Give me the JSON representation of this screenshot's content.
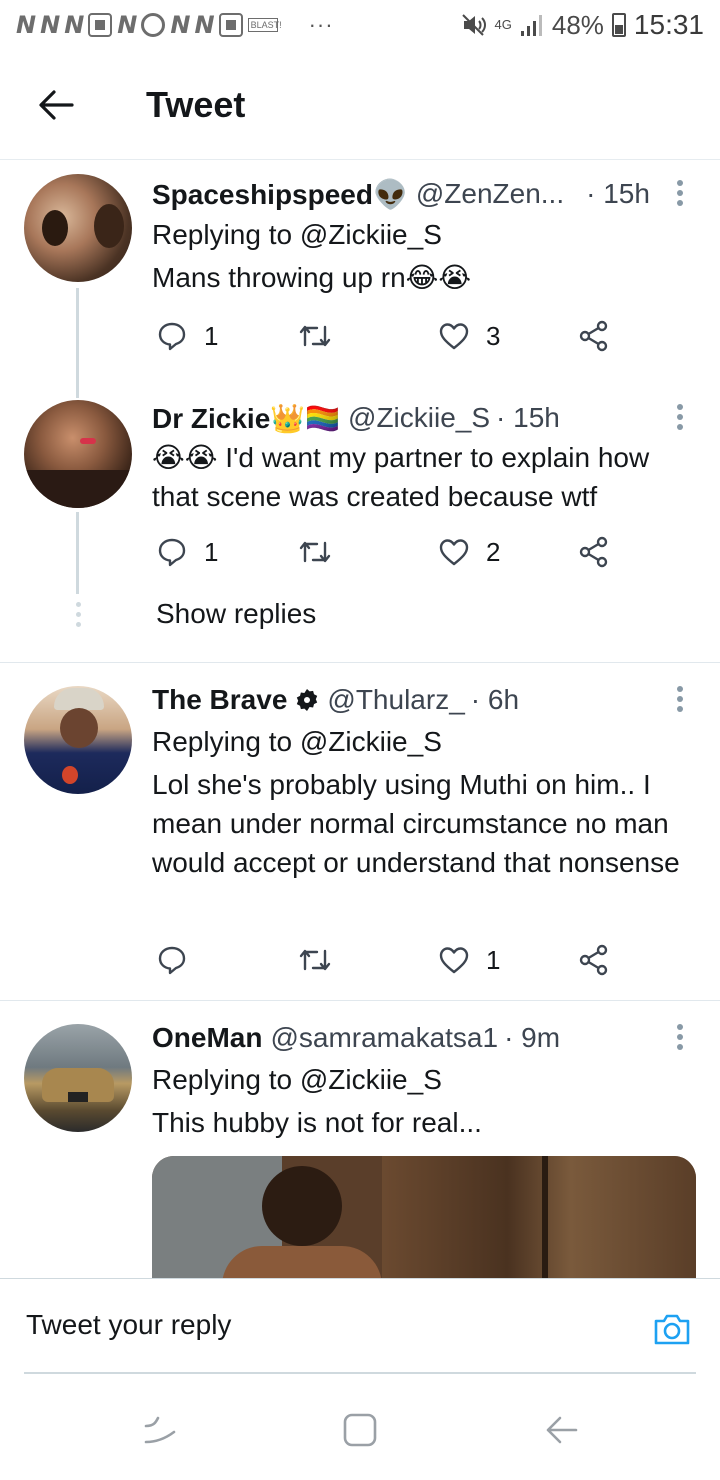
{
  "status_bar": {
    "notif_letters": [
      "N",
      "N",
      "N"
    ],
    "notif_letters_2": [
      "N",
      "N"
    ],
    "blast_label": "BLAST!",
    "dots": "···",
    "network": "4G",
    "battery": "48%",
    "time": "15:31"
  },
  "header": {
    "title": "Tweet"
  },
  "tweets": [
    {
      "name": "Spaceshipspeed👽",
      "handle": "@ZenZen...",
      "time": "· 15h",
      "replying": "Replying to @Zickiie_S",
      "text": "Mans throwing up rn😂😭",
      "replies": "1",
      "retweets": "",
      "likes": "3"
    },
    {
      "name": "Dr Zickie👑🏳️‍🌈",
      "handle": "@Zickiie_S",
      "time": "· 15h",
      "replying": "",
      "text": "😭😭 I'd want my partner to explain how that scene was created because wtf",
      "replies": "1",
      "retweets": "",
      "likes": "2"
    },
    {
      "name": "The Brave",
      "handle": "@Thularz_",
      "time": "· 6h",
      "replying": "Replying to @Zickiie_S",
      "text": "Lol she's probably using Muthi on him.. I mean under normal circumstance no man would accept or understand that nonsense",
      "replies": "",
      "retweets": "",
      "likes": "1"
    },
    {
      "name": "OneMan",
      "handle": "@samramakatsa1",
      "time": "· 9m",
      "replying": "Replying to @Zickiie_S",
      "text": "This hubby is not for real...",
      "replies": "",
      "retweets": "",
      "likes": ""
    }
  ],
  "show_replies": "Show replies",
  "reply_bar": {
    "placeholder": "Tweet your reply"
  },
  "colors": {
    "accent": "#1da1f2",
    "text": "#14171a",
    "icon": "#3d4550",
    "divider": "#e1e8ed"
  },
  "icons": [
    "back-arrow-icon",
    "more-icon",
    "reply-icon",
    "retweet-icon",
    "like-icon",
    "share-icon",
    "camera-icon",
    "recents-icon",
    "home-icon",
    "back-nav-icon",
    "verified-badge-icon"
  ]
}
